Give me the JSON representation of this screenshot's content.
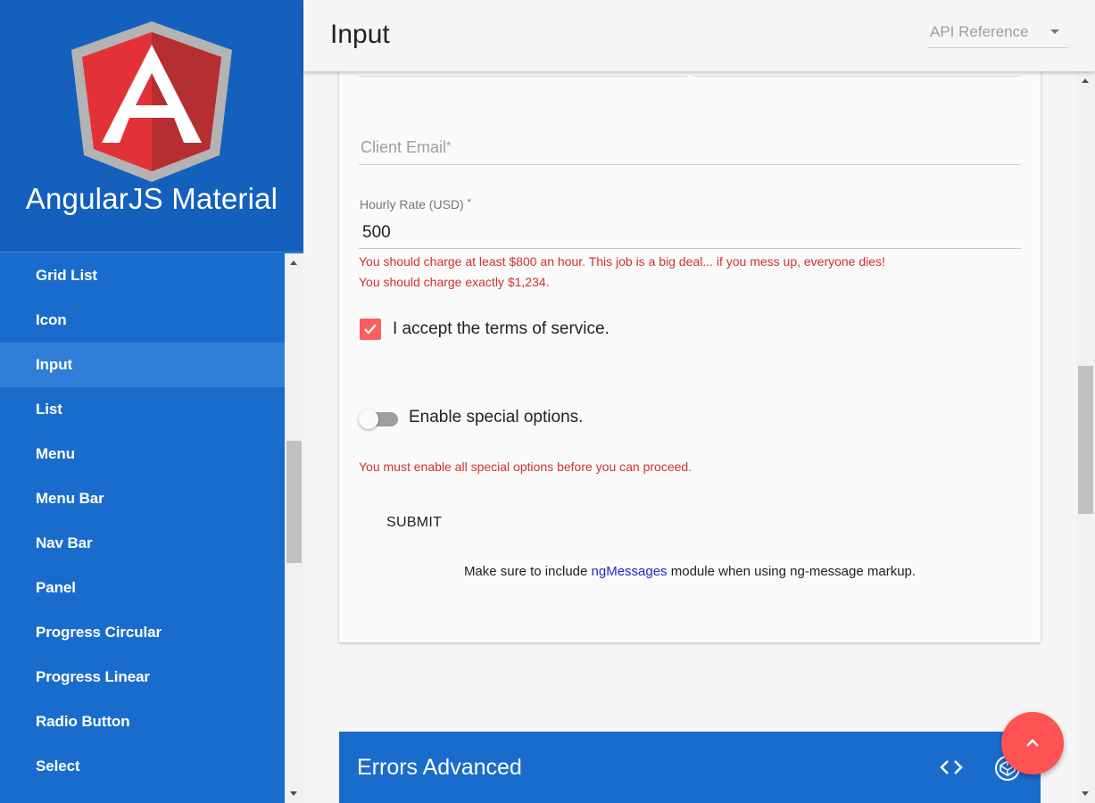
{
  "sidebar": {
    "brand_title": "AngularJS Material",
    "items": [
      {
        "label": "Grid List"
      },
      {
        "label": "Icon"
      },
      {
        "label": "Input"
      },
      {
        "label": "List"
      },
      {
        "label": "Menu"
      },
      {
        "label": "Menu Bar"
      },
      {
        "label": "Nav Bar"
      },
      {
        "label": "Panel"
      },
      {
        "label": "Progress Circular"
      },
      {
        "label": "Progress Linear"
      },
      {
        "label": "Radio Button"
      },
      {
        "label": "Select"
      }
    ],
    "active_item": "Input"
  },
  "toolbar": {
    "title": "Input",
    "api_select_value": "API Reference"
  },
  "form": {
    "email_label": "Client Email",
    "required_mark": "*",
    "rate_label": "Hourly Rate (USD)",
    "rate_value": "500",
    "errors": [
      "You should charge at least $800 an hour. This job is a big deal... if you mess up, everyone dies!",
      "You should charge exactly $1,234."
    ],
    "terms_label": "I accept the terms of service.",
    "terms_checked": true,
    "switch_label": "Enable special options.",
    "switch_on": false,
    "switch_error": "You must enable all special options before you can proceed.",
    "submit_label": "SUBMIT",
    "note_before": "Make sure to include ",
    "note_link": "ngMessages",
    "note_after": " module when using ng-message markup."
  },
  "section": {
    "title": "Errors Advanced"
  },
  "icons": {
    "logo": "angularjs-shield-logo",
    "code": "code-icon",
    "codepen": "codepen-icon",
    "fab": "chevron-up-icon"
  },
  "colors": {
    "primary": "#1a6ccc",
    "accent": "#ff5252",
    "error": "#d32f2f",
    "link": "#2526c9"
  }
}
